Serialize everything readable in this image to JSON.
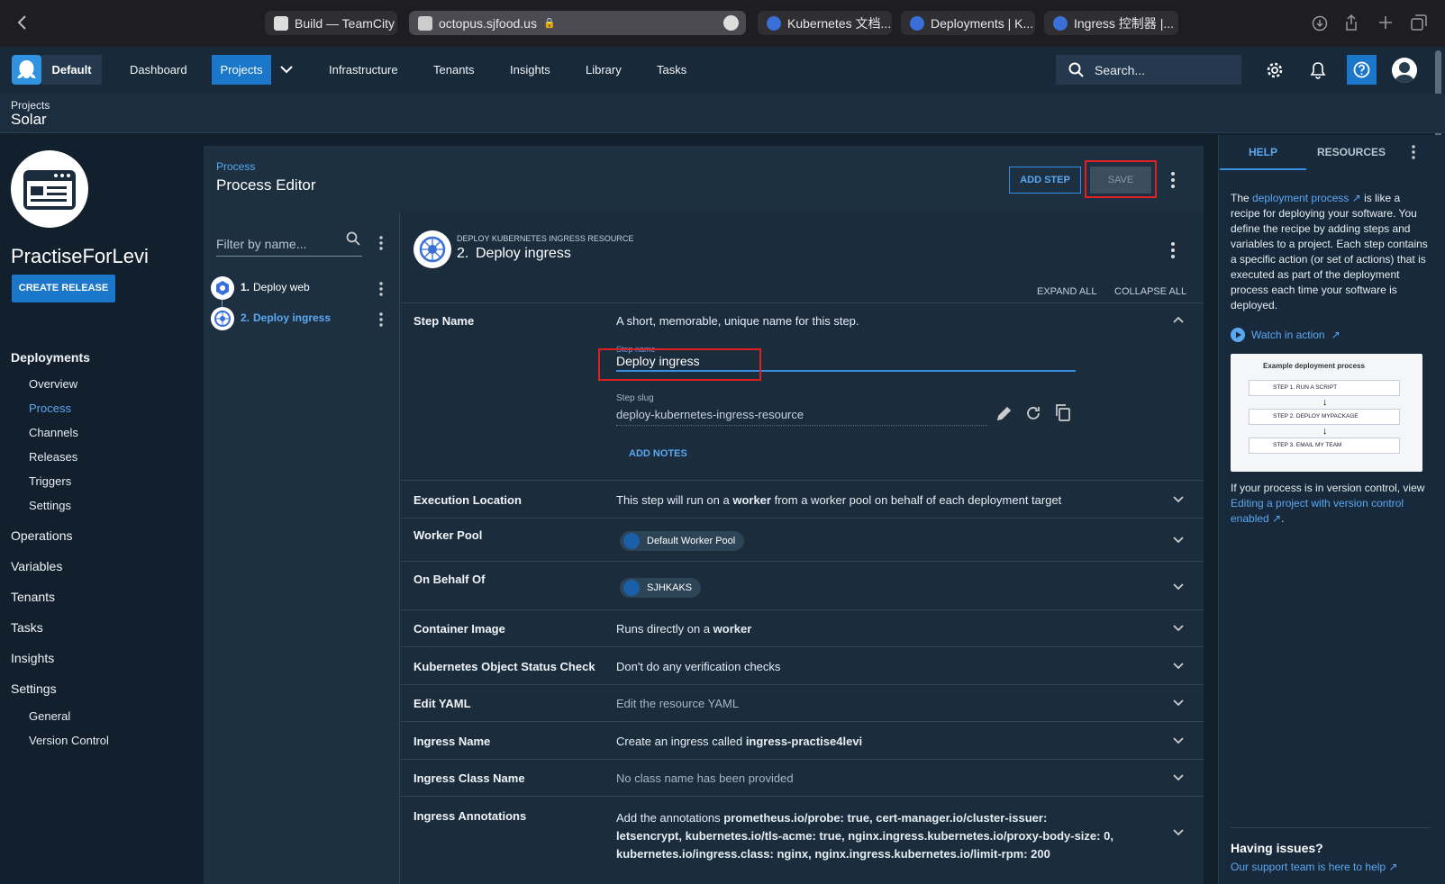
{
  "browser": {
    "tabs": [
      {
        "label": "Build — TeamCity"
      },
      {
        "label": "octopus.sjfood.us"
      },
      {
        "label": "Kubernetes 文档..."
      },
      {
        "label": "Deployments | K..."
      },
      {
        "label": "Ingress 控制器 |..."
      }
    ]
  },
  "nav": {
    "space": "Default",
    "items": [
      "Dashboard",
      "Projects",
      "Infrastructure",
      "Tenants",
      "Insights",
      "Library",
      "Tasks"
    ],
    "search_placeholder": "Search..."
  },
  "breadcrumb": {
    "parent": "Projects",
    "current": "Solar"
  },
  "project": {
    "name": "PractiseForLevi",
    "create_release": "CREATE RELEASE"
  },
  "sidebar": {
    "deployments": "Deployments",
    "deploy_items": [
      "Overview",
      "Process",
      "Channels",
      "Releases",
      "Triggers",
      "Settings"
    ],
    "operations": "Operations",
    "variables": "Variables",
    "tenants": "Tenants",
    "tasks": "Tasks",
    "insights": "Insights",
    "settings": "Settings",
    "settings_items": [
      "General",
      "Version Control"
    ]
  },
  "process": {
    "crumb": "Process",
    "title": "Process Editor",
    "add_step": "ADD STEP",
    "save": "SAVE",
    "filter_placeholder": "Filter by name...",
    "steps": [
      {
        "num": "1.",
        "name": "Deploy web"
      },
      {
        "num": "2.",
        "name": "Deploy ingress"
      }
    ]
  },
  "step": {
    "type": "DEPLOY KUBERNETES INGRESS RESOURCE",
    "num": "2.",
    "title": "Deploy ingress",
    "expand_all": "EXPAND ALL",
    "collapse_all": "COLLAPSE ALL",
    "step_name_label": "Step Name",
    "step_name_desc": "A short, memorable, unique name for this step.",
    "field_label": "Step name",
    "field_value": "Deploy ingress",
    "slug_label": "Step slug",
    "slug_value": "deploy-kubernetes-ingress-resource",
    "add_notes": "ADD NOTES",
    "exec_label": "Execution Location",
    "exec_a": "This step will run on a ",
    "exec_b": "worker",
    "exec_c": " from a worker pool on behalf of each deployment target",
    "pool_label": "Worker Pool",
    "pool_chip": "Default Worker Pool",
    "behalf_label": "On Behalf Of",
    "behalf_chip": "SJHKAKS",
    "container_label": "Container Image",
    "container_a": "Runs directly on a ",
    "container_b": "worker",
    "status_label": "Kubernetes Object Status Check",
    "status_value": "Don't do any verification checks",
    "yaml_label": "Edit YAML",
    "yaml_value": "Edit the resource YAML",
    "ingress_label": "Ingress Name",
    "ingress_a": "Create an ingress called ",
    "ingress_b": "ingress-practise4levi",
    "class_label": "Ingress Class Name",
    "class_value": "No class name has been provided",
    "annot_label": "Ingress Annotations",
    "annot_a": "Add the annotations ",
    "annot_line1": "prometheus.io/probe: true, cert-manager.io/cluster-issuer:",
    "annot_line2": "letsencrypt, kubernetes.io/tls-acme: true, nginx.ingress.kubernetes.io/proxy-body-size: 0,",
    "annot_line3": "kubernetes.io/ingress.class: nginx, nginx.ingress.kubernetes.io/limit-rpm: 200"
  },
  "help": {
    "tab_help": "HELP",
    "tab_resources": "RESOURCES",
    "p1_a": "The ",
    "p1_link": "deployment process",
    "p1_b": " is like a recipe for deploying your software. You define the recipe by adding steps and variables to a project. Each step contains a specific action (or set of actions) that is executed as part of the deployment process each time your software is deployed.",
    "watch": "Watch in action",
    "diagram_title": "Example deployment process",
    "diagram_steps": [
      "STEP 1. RUN A SCRIPT",
      "STEP 2. DEPLOY MYPACKAGE",
      "STEP 3. EMAIL MY TEAM"
    ],
    "p2_a": "If your process is in version control, view ",
    "p2_link": "Editing a project with version control enabled",
    "p2_b": ".",
    "issues_title": "Having issues?",
    "issues_link": "Our support team is here to help"
  },
  "colors": {
    "accent": "#1a77ca",
    "link": "#5ca8f0",
    "highlight": "#e02020",
    "background": "#12202d"
  }
}
